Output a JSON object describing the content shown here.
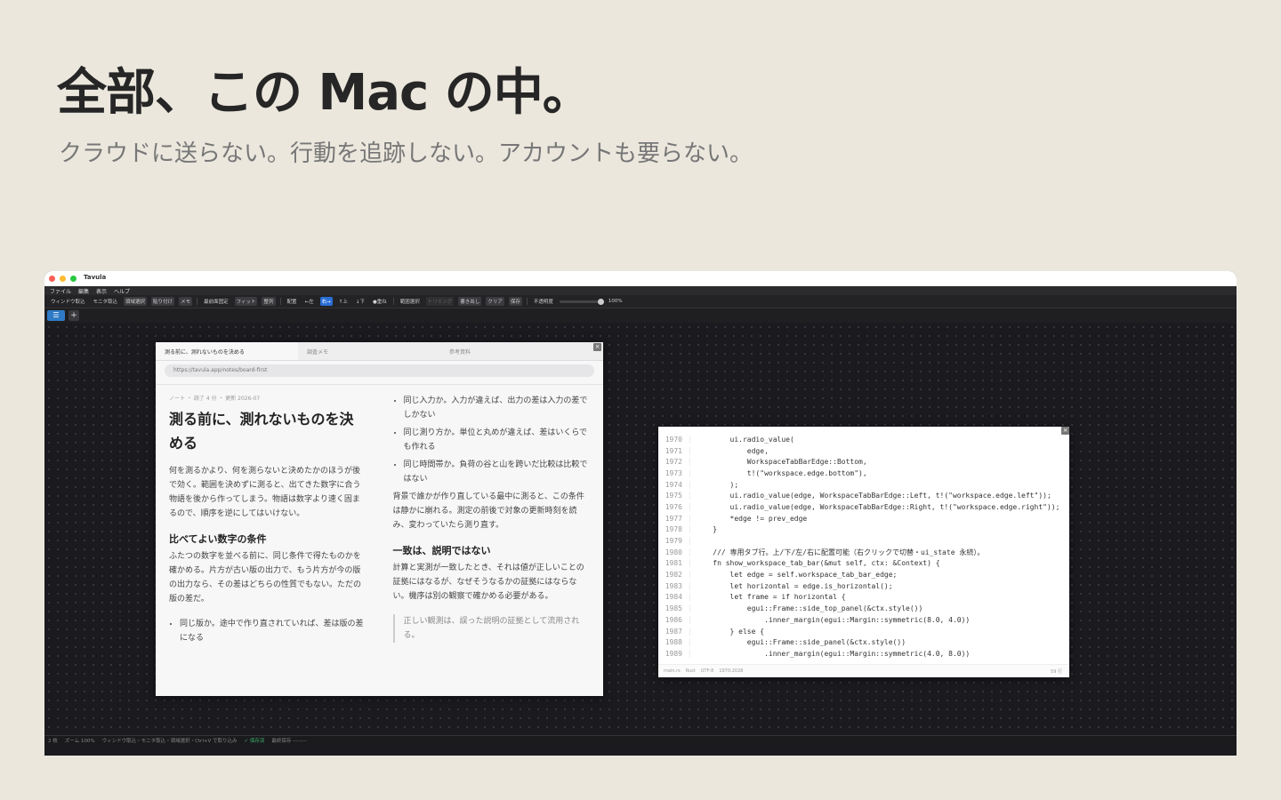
{
  "hero": {
    "title": "全部、この Mac の中。",
    "subtitle": "クラウドに送らない。行動を追跡しない。アカウントも要らない。"
  },
  "window": {
    "app_title": "Tavula",
    "menus": [
      "ファイル",
      "編集",
      "表示",
      "ヘルプ"
    ],
    "toolbar": {
      "window_capture": "ウィンドウ取込",
      "monitor_capture": "モニタ取込",
      "region_select": "領域選択",
      "paste": "貼り付け",
      "memo": "メモ",
      "pin_front": "最前面固定",
      "fit": "フィット",
      "arrange": "整列",
      "layout_label": "配置",
      "left": "←左",
      "right": "右→",
      "up": "↑上",
      "down": "↓下",
      "stack": "●重ね",
      "range_select": "範囲選択",
      "trim": "トリミング",
      "export": "書き出し",
      "clear": "クリア",
      "save": "保存",
      "opacity_label": "不透明度",
      "opacity_value": "100%",
      "opacity_level": 1.0
    },
    "tabs": {
      "add": "+"
    },
    "status": {
      "count": "2 枚",
      "zoom": "ズーム 100%",
      "hint": "ウィンドウ取込・モニタ取込・領域選択・Ctrl+V で取り込み",
      "saved": "✓ 保存済",
      "last_saved": "最終保存 --:--:--"
    }
  },
  "note": {
    "tabs": [
      "測る前に、測れないものを決める",
      "調査メモ",
      "参考資料"
    ],
    "url": "https://tavula.app/notes/board-first",
    "meta": "ノート ・ 読了 4 分 ・ 更新 2026-07",
    "title": "測る前に、測れないものを決める",
    "intro": "何を測るかより、何を測らないと決めたかのほうが後で効く。範囲を決めずに測ると、出てきた数字に合う物語を後から作ってしまう。物語は数字より速く固まるので、順序を逆にしてはいけない。",
    "h_compare": "比べてよい数字の条件",
    "compare_para": "ふたつの数字を並べる前に、同じ条件で得たものかを確かめる。片方が古い版の出力で、もう片方が今の版の出力なら、その差はどちらの性質でもない。ただの版の差だ。",
    "bullets_left": [
      "同じ版か。途中で作り直されていれば、差は版の差になる"
    ],
    "bullets_right": [
      "同じ入力か。入力が違えば、出力の差は入力の差でしかない",
      "同じ測り方か。単位と丸めが違えば、差はいくらでも作れる",
      "同じ時間帯か。負荷の谷と山を跨いだ比較は比較ではない"
    ],
    "bg_para": "背景で誰かが作り直している最中に測ると、この条件は静かに崩れる。測定の前後で対象の更新時刻を読み、変わっていたら測り直す。",
    "h_agree": "一致は、説明ではない",
    "agree_para": "計算と実測が一致したとき、それは値が正しいことの証拠にはなるが、なぜそうなるかの証拠にはならない。機序は別の観察で確かめる必要がある。",
    "quote": "正しい観測は、誤った説明の証拠として流用される。",
    "close": "×"
  },
  "code": {
    "close": "×",
    "lines": [
      {
        "n": "1970",
        "t": "        ui.radio_value("
      },
      {
        "n": "1971",
        "t": "            edge,"
      },
      {
        "n": "1972",
        "t": "            WorkspaceTabBarEdge::Bottom,"
      },
      {
        "n": "1973",
        "t": "            t!(\"workspace.edge.bottom\"),"
      },
      {
        "n": "1974",
        "t": "        );"
      },
      {
        "n": "1975",
        "t": "        ui.radio_value(edge, WorkspaceTabBarEdge::Left, t!(\"workspace.edge.left\"));"
      },
      {
        "n": "1976",
        "t": "        ui.radio_value(edge, WorkspaceTabBarEdge::Right, t!(\"workspace.edge.right\"));"
      },
      {
        "n": "1977",
        "t": "        *edge != prev_edge"
      },
      {
        "n": "1978",
        "t": "    }"
      },
      {
        "n": "1979",
        "t": ""
      },
      {
        "n": "1980",
        "t": "    /// 専用タブ行。上/下/左/右に配置可能（右クリックで切替・ui_state 永続）。"
      },
      {
        "n": "1981",
        "t": "    fn show_workspace_tab_bar(&mut self, ctx: &Context) {"
      },
      {
        "n": "1982",
        "t": "        let edge = self.workspace_tab_bar_edge;"
      },
      {
        "n": "1983",
        "t": "        let horizontal = edge.is_horizontal();"
      },
      {
        "n": "1984",
        "t": "        let frame = if horizontal {"
      },
      {
        "n": "1985",
        "t": "            egui::Frame::side_top_panel(&ctx.style())"
      },
      {
        "n": "1986",
        "t": "                .inner_margin(egui::Margin::symmetric(8.0, 4.0))"
      },
      {
        "n": "1987",
        "t": "        } else {"
      },
      {
        "n": "1988",
        "t": "            egui::Frame::side_panel(&ctx.style())"
      },
      {
        "n": "1989",
        "t": "                .inner_margin(egui::Margin::symmetric(4.0, 8.0))"
      }
    ],
    "status": {
      "file": "main.rs",
      "lang": "Rust",
      "encoding": "UTF-8",
      "range": "1970:2028",
      "lines_count": "59 行"
    }
  },
  "colors": {
    "background": "#ebe7dd",
    "app_bg": "#1b1b1f",
    "accent": "#2a6fd6",
    "saved": "#3db46d"
  }
}
